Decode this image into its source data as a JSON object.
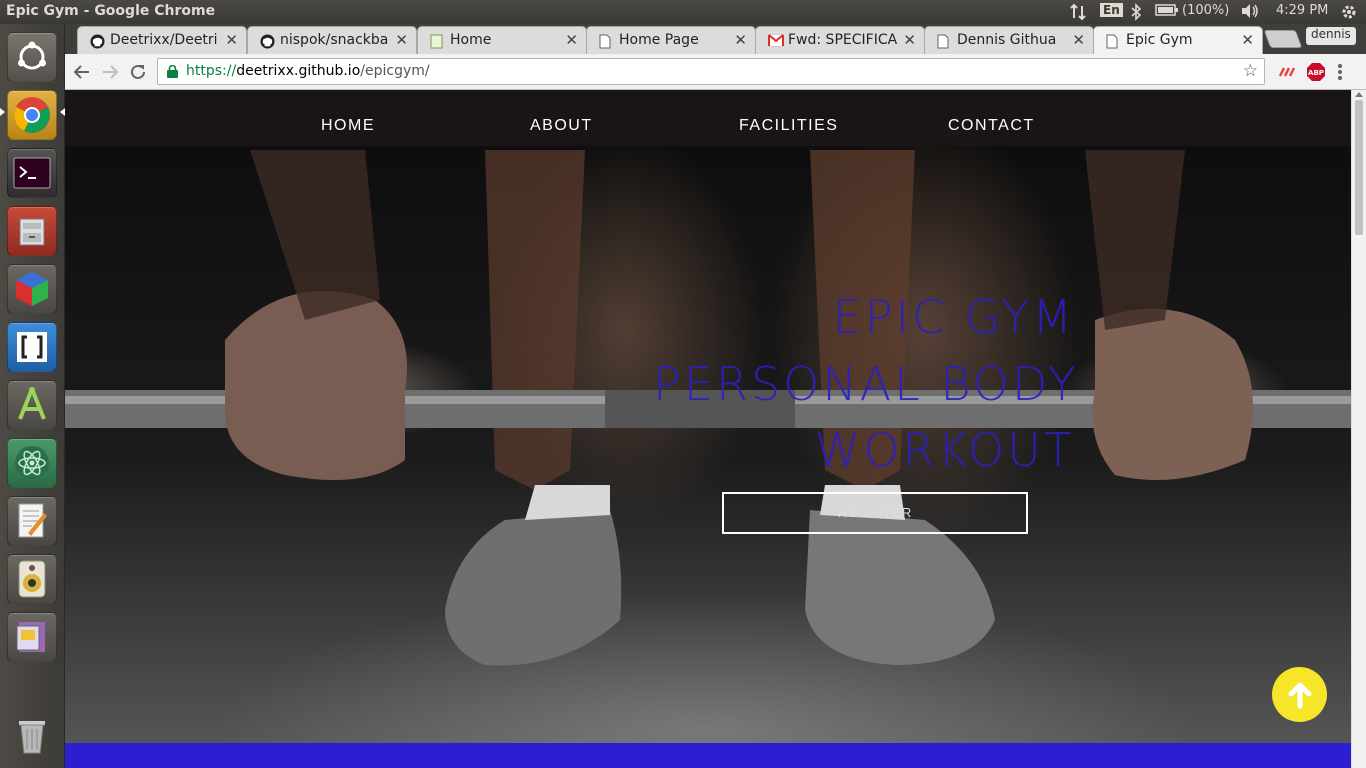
{
  "system": {
    "window_title": "Epic Gym - Google Chrome",
    "keyboard_layout": "En",
    "battery": "(100%)",
    "clock": "4:29 PM"
  },
  "launcher": {
    "items": [
      "dash-icon",
      "chrome-icon",
      "terminal-icon",
      "files-icon",
      "cube-app-icon",
      "brackets-icon",
      "android-studio-icon",
      "atom-icon",
      "text-editor-icon",
      "speaker-icon",
      "media-app-icon",
      "trash-icon"
    ]
  },
  "browser": {
    "tabs": [
      {
        "title": "Deetrixx/Deetri",
        "icon": "github-icon"
      },
      {
        "title": "nispok/snackba",
        "icon": "github-icon"
      },
      {
        "title": "Home",
        "icon": "page-icon"
      },
      {
        "title": "Home Page",
        "icon": "page-icon"
      },
      {
        "title": "Fwd: SPECIFICA",
        "icon": "gmail-icon"
      },
      {
        "title": "Dennis Githua",
        "icon": "page-icon"
      },
      {
        "title": "Epic Gym",
        "icon": "page-icon",
        "active": true
      }
    ],
    "profile_name": "dennis",
    "url": {
      "scheme": "https://",
      "host": "deetrixx.github.io",
      "path": "/epicgym/"
    }
  },
  "site": {
    "nav": [
      "HOME",
      "ABOUT",
      "FACILITIES",
      "CONTACT"
    ],
    "hero": {
      "line1": "EPIC GYM",
      "line2": "PERSONAL BODY",
      "line3": "WORKOUT",
      "button": "REGISTER",
      "heading_color": "#2c20c0"
    },
    "band_color": "#2b1fd1",
    "to_top_color": "#f7e52a"
  }
}
